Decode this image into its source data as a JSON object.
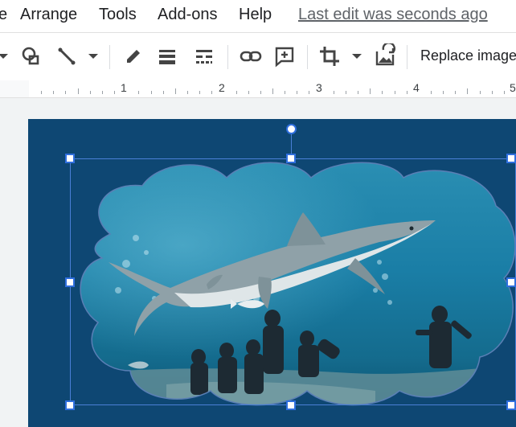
{
  "menubar": {
    "items": [
      {
        "label": "e"
      },
      {
        "label": "Arrange"
      },
      {
        "label": "Tools"
      },
      {
        "label": "Add-ons"
      },
      {
        "label": "Help"
      }
    ],
    "last_edit": "Last edit was seconds ago"
  },
  "toolbar": {
    "icons": [
      "dropdown-arrow-icon",
      "shape-icon",
      "line-icon",
      "line-dropdown-icon",
      "pencil-icon",
      "line-weight-icon",
      "line-dash-icon",
      "link-icon",
      "add-comment-icon",
      "crop-icon",
      "mask-dropdown-icon",
      "reset-image-icon"
    ],
    "replace_image_label": "Replace image"
  },
  "ruler": {
    "numbers": [
      "1",
      "2",
      "3",
      "4",
      "5"
    ]
  },
  "canvas": {
    "slide_color": "#0e4773",
    "image_subject": "shark-and-divers-photo",
    "selection_color": "#4a7fd6"
  }
}
